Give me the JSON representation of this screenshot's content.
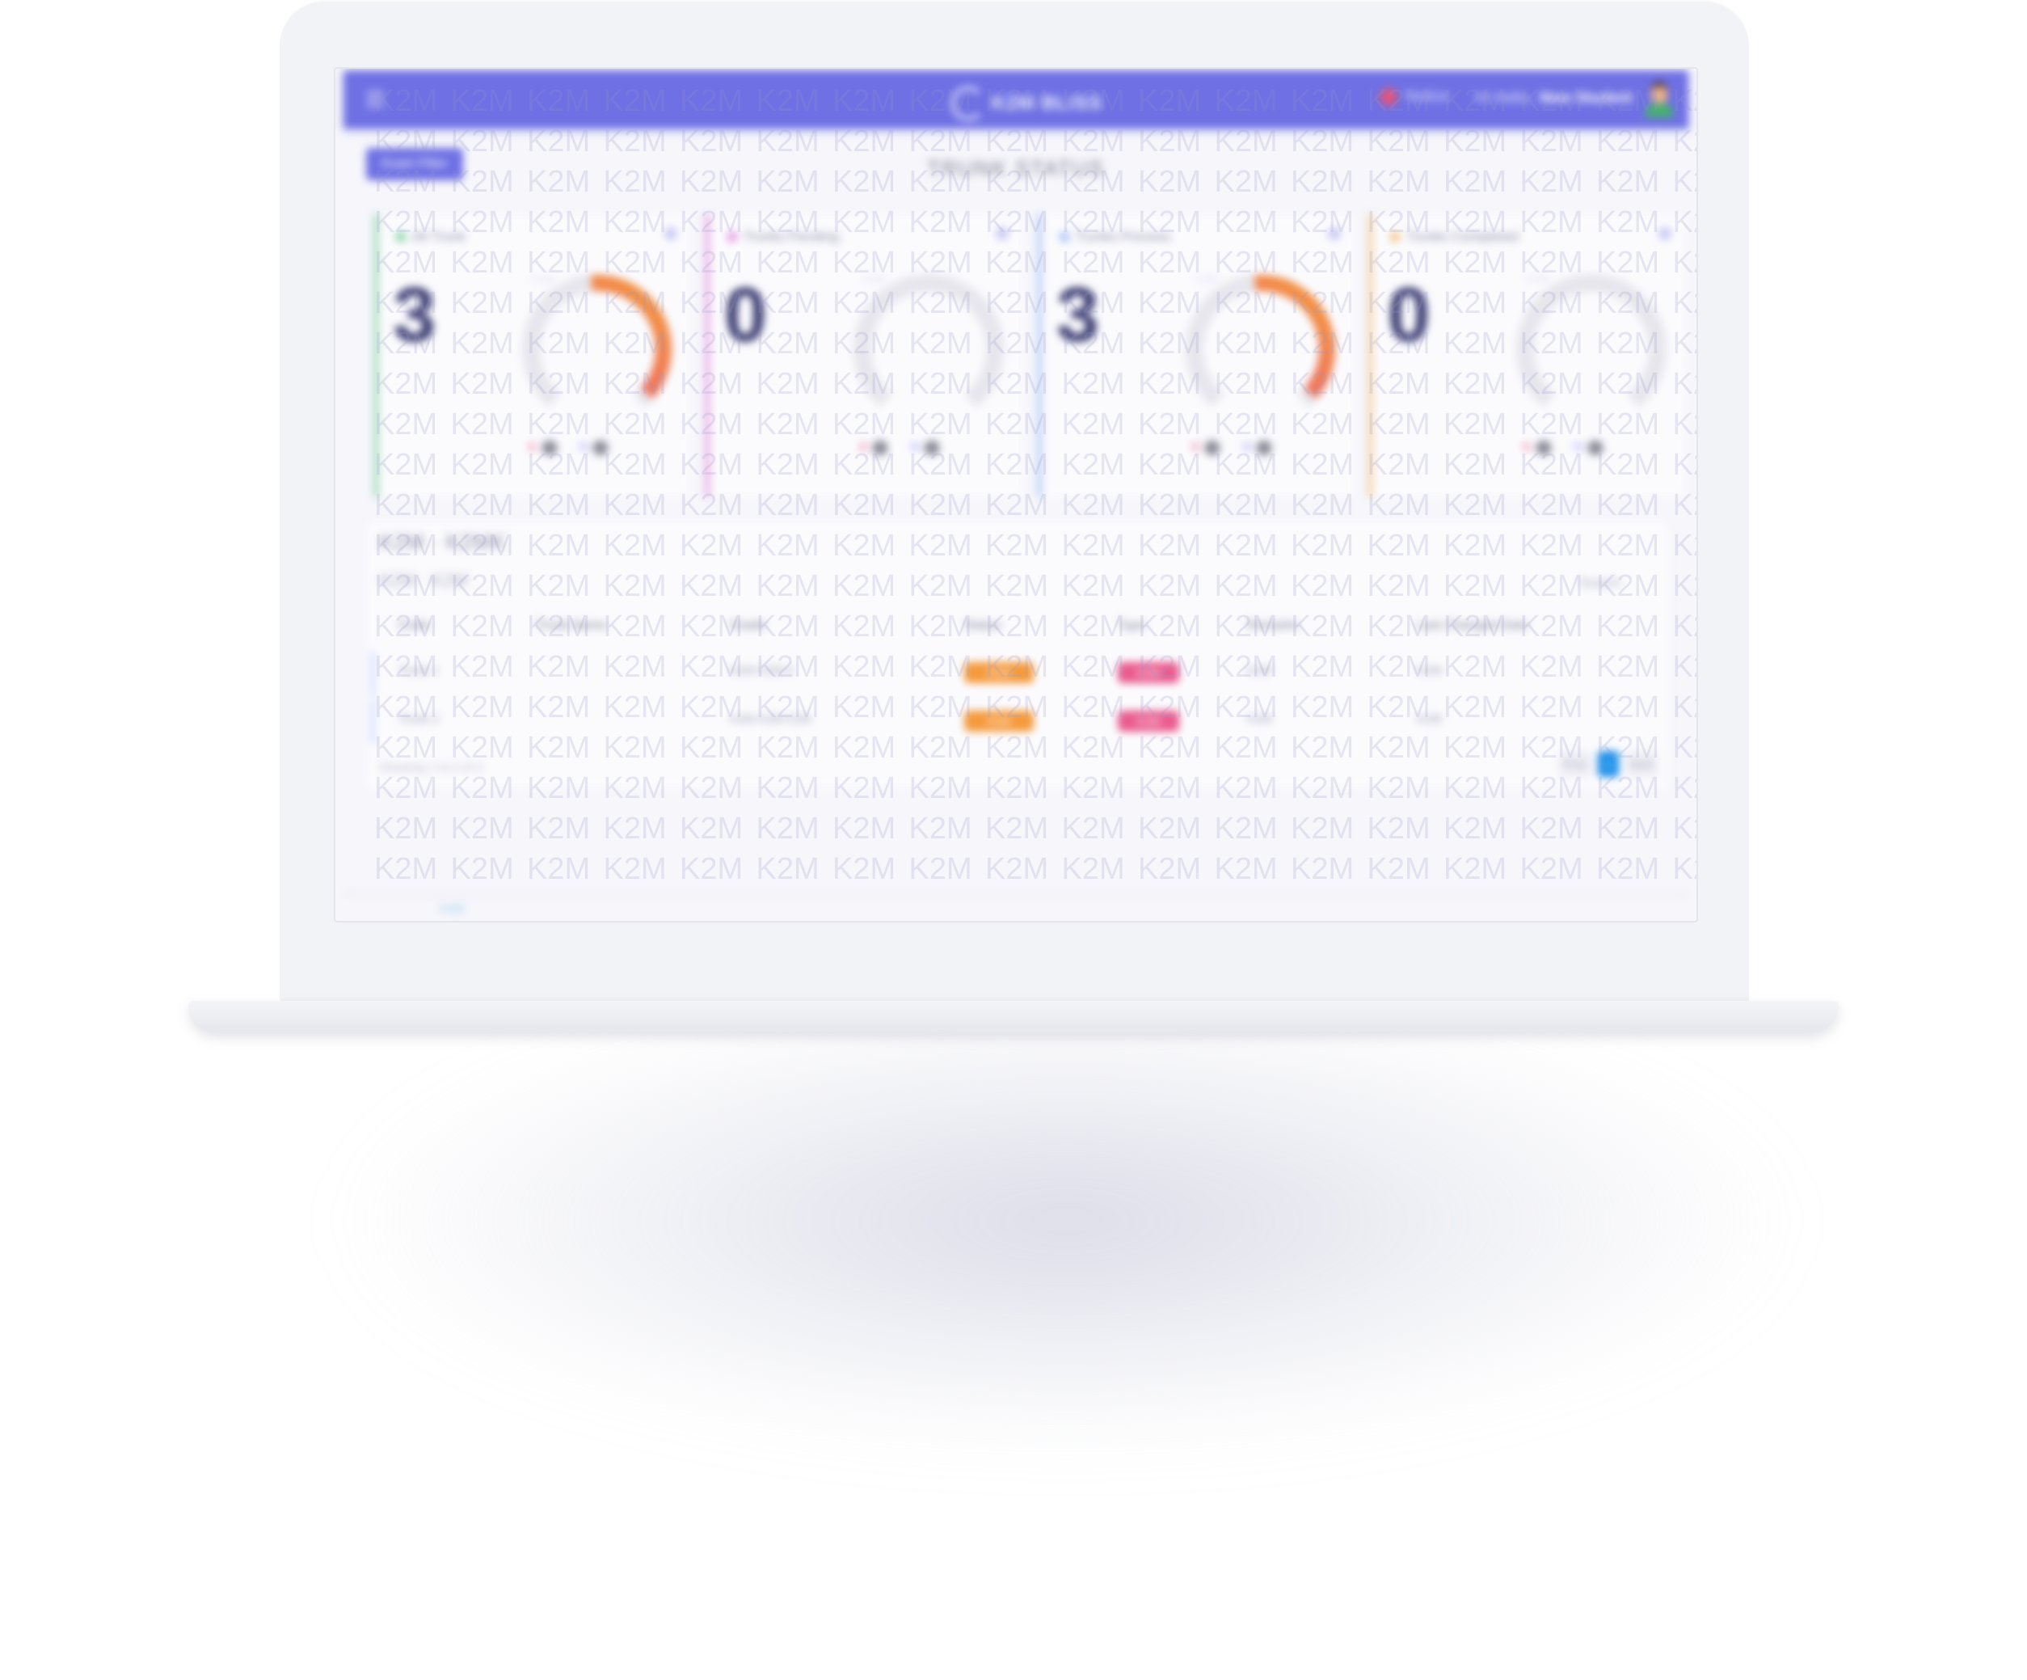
{
  "app": {
    "brand_name": "K2M BLISS",
    "notification_label": "Notice",
    "greeting": "Hi Hello,",
    "user_name": "New Student"
  },
  "toolbar": {
    "filter_button": "Exam Filter"
  },
  "page_title": "TRUNK STATUS",
  "stat_cards": [
    {
      "title": "All Trunk",
      "value": "3",
      "ring_label": "K2M",
      "legend_a": "K",
      "legend_a_value": "0",
      "legend_b": "N",
      "legend_b_value": "0",
      "accent": "#8bd6a8",
      "fill": 0.35
    },
    {
      "title": "Trunks Pending",
      "value": "0",
      "ring_label": "K2M",
      "legend_a": "K",
      "legend_a_value": "0",
      "legend_b": "N",
      "legend_b_value": "0",
      "accent": "#e79be0",
      "fill": 0.0
    },
    {
      "title": "Trunks Process",
      "value": "3",
      "ring_label": "K2M",
      "legend_a": "K",
      "legend_a_value": "0",
      "legend_b": "N",
      "legend_b_value": "0",
      "accent": "#a9c4f5",
      "fill": 0.35
    },
    {
      "title": "Trunks Completed",
      "value": "0",
      "ring_label": "K2M",
      "legend_a": "K",
      "legend_a_value": "0",
      "legend_b": "N",
      "legend_b_value": "0",
      "accent": "#f3c98a",
      "fill": 0.0
    }
  ],
  "table": {
    "title": "K2M · K2MK",
    "subtitle": "K2M · K2M",
    "search_label": "Search",
    "headers": [
      "Code",
      "Trunk Name",
      "Grade",
      "Status",
      "Type",
      "Remarks",
      "Last Changed Date"
    ],
    "rows": [
      {
        "code": "Trunk 1",
        "name": "",
        "grade": "K2M K2M K",
        "status": "K2M",
        "type": "K2M",
        "remarks": "K2M",
        "date": "K2M"
      },
      {
        "code": "Trunk 2",
        "name": "",
        "grade": "K2M K2M K2M",
        "status": "K2M",
        "type": "K2M",
        "remarks": "K2M",
        "date": "K2M"
      }
    ],
    "pager_info": "Showing 1 to 2 of 2",
    "pager_prev": "Prev",
    "pager_page": "1",
    "pager_next": "Next"
  },
  "footer": {
    "text": "K2M"
  },
  "watermark_text": "K2M",
  "colors": {
    "appbar": "#6e70e4",
    "ring_track": "#e6e6ec",
    "ring_pink": "#ea4c7c",
    "ring_orange": "#f59a3c",
    "status_pill": "#f59a3c",
    "type_pill": "#ea5b8e",
    "page_active": "#1a8fe8"
  }
}
